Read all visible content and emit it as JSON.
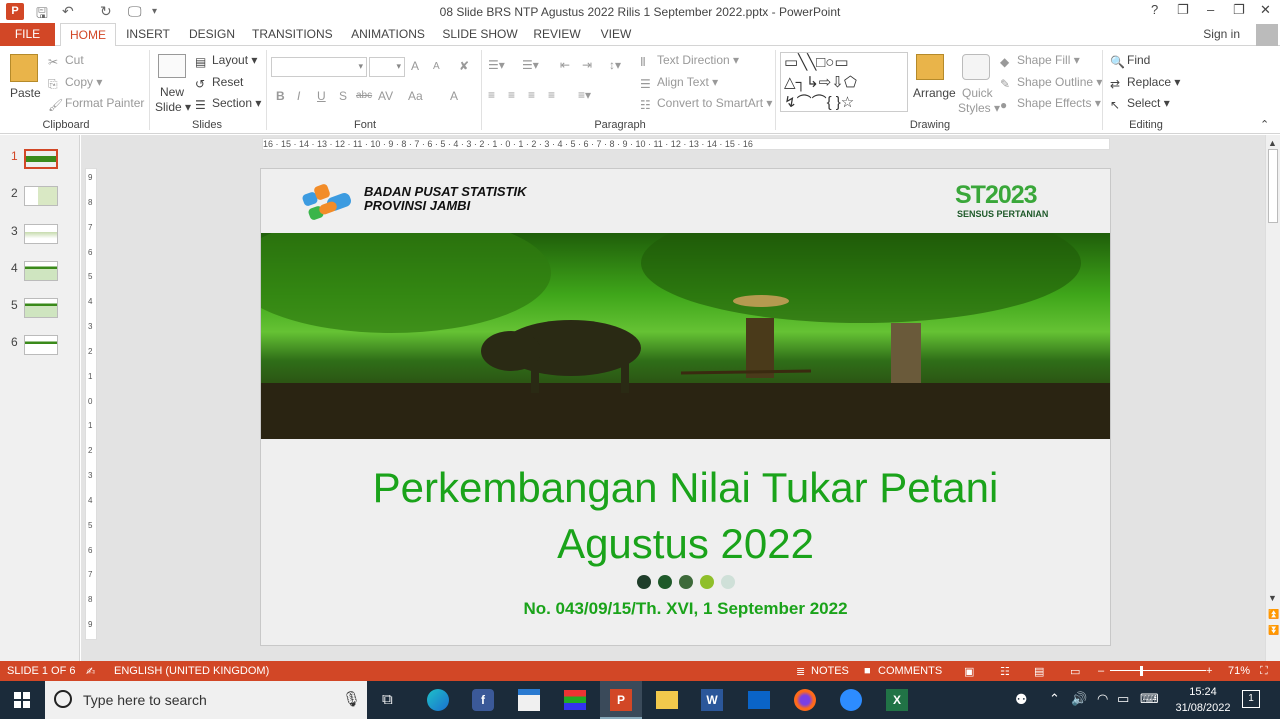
{
  "titlebar": {
    "app_icon_letter": "P",
    "title": "08 Slide BRS NTP Agustus 2022 Rilis 1 September 2022.pptx - PowerPoint",
    "help": "?",
    "minimize": "–",
    "restore": "❐",
    "close": "✕"
  },
  "tabs": {
    "file": "FILE",
    "home": "HOME",
    "insert": "INSERT",
    "design": "DESIGN",
    "transitions": "TRANSITIONS",
    "animations": "ANIMATIONS",
    "slideshow": "SLIDE SHOW",
    "review": "REVIEW",
    "view": "VIEW",
    "signin": "Sign in"
  },
  "ribbon": {
    "clipboard": {
      "paste": "Paste",
      "cut": "Cut",
      "copy": "Copy",
      "format_painter": "Format Painter",
      "label": "Clipboard"
    },
    "slides": {
      "new_slide": "New",
      "new_slide2": "Slide",
      "layout": "Layout",
      "reset": "Reset",
      "section": "Section",
      "label": "Slides"
    },
    "font": {
      "bold": "B",
      "italic": "I",
      "underline": "U",
      "shadow": "S",
      "strike": "abc",
      "spacing": "AV",
      "case": "Aa",
      "color": "A",
      "grow": "A",
      "shrink": "A",
      "label": "Font"
    },
    "paragraph": {
      "text_direction": "Text Direction",
      "align_text": "Align Text",
      "convert_smartart": "Convert to SmartArt",
      "label": "Paragraph"
    },
    "drawing": {
      "arrange": "Arrange",
      "quick_styles": "Quick",
      "quick_styles2": "Styles",
      "shape_fill": "Shape Fill",
      "shape_outline": "Shape Outline",
      "shape_effects": "Shape Effects",
      "label": "Drawing"
    },
    "editing": {
      "find": "Find",
      "replace": "Replace",
      "select": "Select",
      "label": "Editing"
    }
  },
  "slide_thumbnails": [
    {
      "num": "1"
    },
    {
      "num": "2"
    },
    {
      "num": "3"
    },
    {
      "num": "4"
    },
    {
      "num": "5"
    },
    {
      "num": "6"
    }
  ],
  "ruler": {
    "h_ticks": "16 · 15 · 14 · 13 · 12 · 11 · 10 · 9 · 8 · 7 · 6 · 5 · 4 · 3 · 2 · 1 · 0 · 1 · 2 · 3 · 4 · 5 · 6 · 7 · 8 · 9 · 10 · 11 · 12 · 13 · 14 · 15 · 16",
    "v_ticks": [
      "9",
      "8",
      "7",
      "6",
      "5",
      "4",
      "3",
      "2",
      "1",
      "0",
      "1",
      "2",
      "3",
      "4",
      "5",
      "6",
      "7",
      "8",
      "9"
    ]
  },
  "slide": {
    "org_line1": "BADAN PUSAT STATISTIK",
    "org_line2": "PROVINSI JAMBI",
    "st_logo": "ST2023",
    "st_caption": "SENSUS PERTANIAN",
    "title_line1": "Perkembangan Nilai Tukar Petani",
    "title_line2": "Agustus 2022",
    "subtitle": "No. 043/09/15/Th. XVI, 1 September 2022",
    "dot_colors": [
      "#1f3d2a",
      "#1f5a2a",
      "#3d6a3a",
      "#8fbf2a",
      "#cfe0d8"
    ]
  },
  "status": {
    "slide_of": "SLIDE 1 OF 6",
    "language": "ENGLISH (UNITED KINGDOM)",
    "notes": "NOTES",
    "comments": "COMMENTS",
    "zoom": "71%"
  },
  "taskbar": {
    "search_placeholder": "Type here to search",
    "time": "15:24",
    "date": "31/08/2022",
    "notification_count": "1"
  },
  "colors": {
    "accent": "#d24726",
    "slide_green": "#1aa31a"
  }
}
